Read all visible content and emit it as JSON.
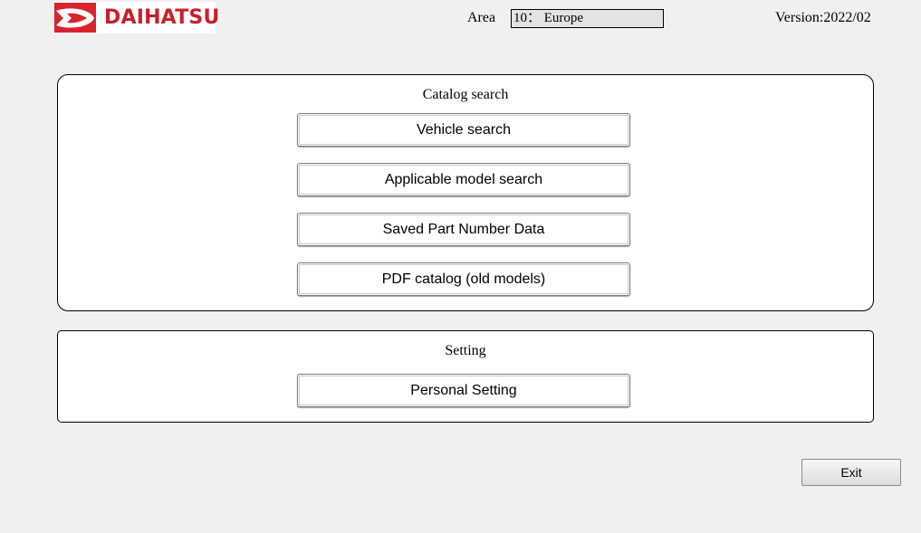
{
  "header": {
    "brand": "DAIHATSU",
    "brand_color": "#d9232d",
    "logo_icon": "daihatsu-d-mark-icon",
    "area_label": "Area",
    "area_value": "10： Europe",
    "version": "Version:2022/02"
  },
  "catalog_search": {
    "title": "Catalog search",
    "buttons": [
      {
        "label": "Vehicle search"
      },
      {
        "label": "Applicable model search"
      },
      {
        "label": "Saved Part Number Data"
      },
      {
        "label": "PDF catalog (old models)"
      }
    ]
  },
  "setting": {
    "title": "Setting",
    "buttons": [
      {
        "label": "Personal Setting"
      }
    ]
  },
  "footer": {
    "exit_label": "Exit"
  }
}
